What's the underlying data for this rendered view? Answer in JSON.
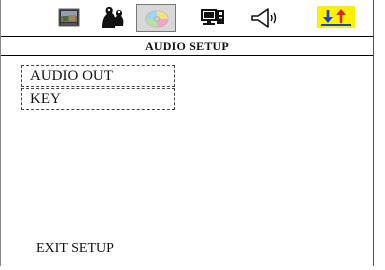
{
  "toolbar": {
    "tabs": [
      {
        "icon": "tv-screen-icon",
        "state": "normal"
      },
      {
        "icon": "people-icon",
        "state": "normal"
      },
      {
        "icon": "disc-icon",
        "state": "selected"
      },
      {
        "icon": "display-settings-icon",
        "state": "normal"
      },
      {
        "icon": "speaker-icon",
        "state": "normal"
      },
      {
        "icon": "updown-arrows-icon",
        "state": "highlighted"
      }
    ],
    "highlight_color": "#fff200"
  },
  "header": {
    "title": "AUDIO SETUP"
  },
  "menu": {
    "items": [
      {
        "label": "AUDIO OUT"
      },
      {
        "label": "KEY"
      }
    ]
  },
  "footer": {
    "exit_label": "EXIT SETUP"
  }
}
